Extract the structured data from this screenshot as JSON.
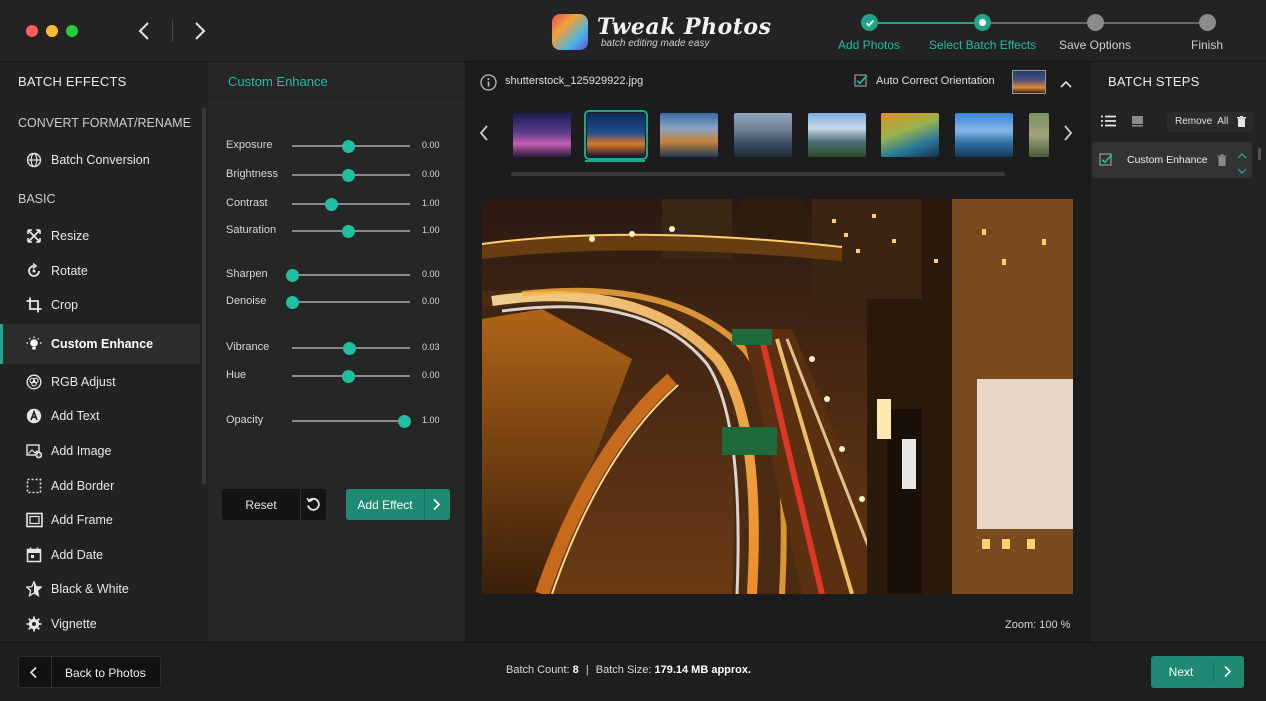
{
  "app": {
    "title": "Tweak Photos",
    "subtitle": "batch editing made easy"
  },
  "steps": [
    {
      "label": "Add Photos",
      "state": "done"
    },
    {
      "label": "Select Batch Effects",
      "state": "current"
    },
    {
      "label": "Save Options",
      "state": "pending"
    },
    {
      "label": "Finish",
      "state": "pending"
    }
  ],
  "left": {
    "header": "BATCH EFFECTS",
    "section_convert": "CONVERT FORMAT/RENAME",
    "section_basic": "BASIC",
    "items": [
      {
        "label": "Batch Conversion",
        "icon": "globe-icon"
      },
      {
        "label": "Resize",
        "icon": "resize-icon"
      },
      {
        "label": "Rotate",
        "icon": "rotate-icon"
      },
      {
        "label": "Crop",
        "icon": "crop-icon"
      },
      {
        "label": "Custom Enhance",
        "icon": "bulb-icon",
        "active": true
      },
      {
        "label": "RGB Adjust",
        "icon": "rgb-icon"
      },
      {
        "label": "Add Text",
        "icon": "text-icon"
      },
      {
        "label": "Add Image",
        "icon": "image-icon"
      },
      {
        "label": "Add Border",
        "icon": "border-icon"
      },
      {
        "label": "Add Frame",
        "icon": "frame-icon"
      },
      {
        "label": "Add Date",
        "icon": "calendar-icon"
      },
      {
        "label": "Black & White",
        "icon": "star-icon"
      },
      {
        "label": "Vignette",
        "icon": "vignette-icon"
      }
    ]
  },
  "enhance": {
    "title": "Custom Enhance",
    "sliders": [
      {
        "label": "Exposure",
        "value": "0.00",
        "level": 0.5
      },
      {
        "label": "Brightness",
        "value": "0.00",
        "level": 0.5
      },
      {
        "label": "Contrast",
        "value": "1.00",
        "level": 0.35
      },
      {
        "label": "Saturation",
        "value": "1.00",
        "level": 0.5
      },
      {
        "label": "Sharpen",
        "value": "0.00",
        "level": 0.0
      },
      {
        "label": "Denoise",
        "value": "0.00",
        "level": 0.0
      },
      {
        "label": "Vibrance",
        "value": "0.03",
        "level": 0.51
      },
      {
        "label": "Hue",
        "value": "0.00",
        "level": 0.5
      },
      {
        "label": "Opacity",
        "value": "1.00",
        "level": 1.0
      }
    ],
    "reset_label": "Reset",
    "add_label": "Add Effect"
  },
  "viewer": {
    "filename": "shutterstock_125929922.jpg",
    "auto_correct_label": "Auto Correct Orientation",
    "auto_correct_checked": true,
    "zoom_label": "Zoom: 100 %",
    "thumbnails_count": 8,
    "selected_thumbnail": 1
  },
  "right": {
    "header": "BATCH STEPS",
    "remove_all_label": "Remove  All",
    "steps": [
      {
        "label": "Custom Enhance",
        "checked": true
      }
    ]
  },
  "footer": {
    "back_label": "Back to Photos",
    "batch_count_label": "Batch Count:",
    "batch_count_value": "8",
    "separator": "|",
    "batch_size_label": "Batch Size:",
    "batch_size_value": "179.14 MB approx.",
    "next_label": "Next"
  },
  "colors": {
    "accent": "#1fa58a",
    "accent_knob": "#1fbf9f",
    "close": "#ff5f57",
    "minimize": "#febc2e",
    "zoom": "#28c840"
  }
}
